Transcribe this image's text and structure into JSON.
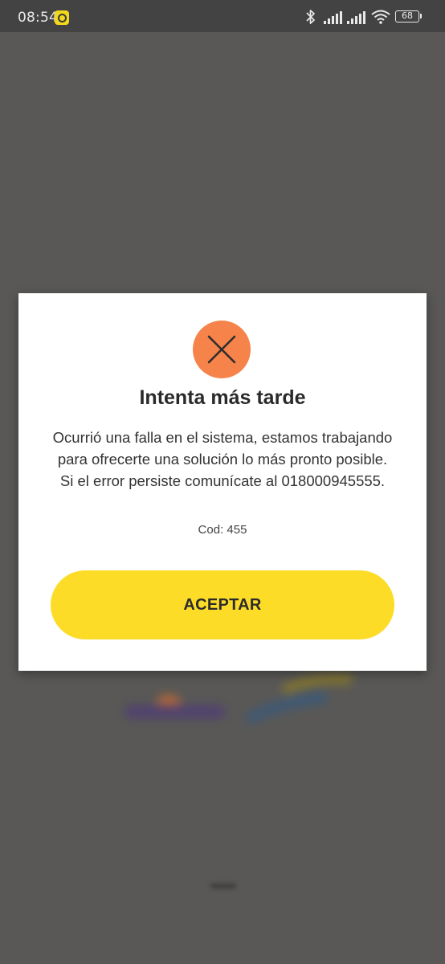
{
  "status_bar": {
    "time": "08:54",
    "battery_level": "68",
    "icons": [
      "notification-badge-icon",
      "bluetooth-icon",
      "signal-icon",
      "signal-icon",
      "wifi-icon",
      "battery-icon"
    ]
  },
  "dialog": {
    "icon": "close-icon",
    "icon_color": "#f5834a",
    "title": "Intenta más tarde",
    "message": "Ocurrió una falla en el sistema, estamos trabajando para ofrecerte una solución lo más pronto posible. Si el error persiste comunícate al 018000945555.",
    "code": "Cod: 455",
    "accept_label": "ACEPTAR",
    "accept_color": "#fddc28"
  },
  "background": {
    "overlay_color": "#595856"
  }
}
